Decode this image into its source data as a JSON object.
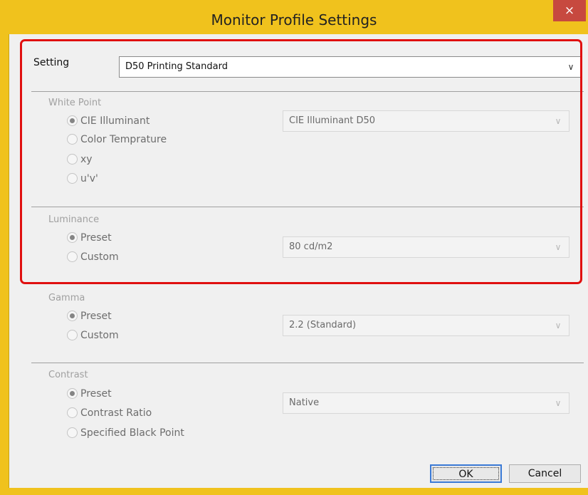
{
  "window": {
    "title": "Monitor Profile Settings",
    "close_label": "×"
  },
  "setting": {
    "label": "Setting",
    "value": "D50 Printing Standard"
  },
  "white_point": {
    "title": "White Point",
    "options": [
      "CIE Illuminant",
      "Color Temprature",
      "xy",
      "u'v'"
    ],
    "selected": 0,
    "combo_value": "CIE Illuminant D50"
  },
  "luminance": {
    "title": "Luminance",
    "options": [
      "Preset",
      "Custom"
    ],
    "selected": 0,
    "combo_value": "80 cd/m2"
  },
  "gamma": {
    "title": "Gamma",
    "options": [
      "Preset",
      "Custom"
    ],
    "selected": 0,
    "combo_value": "2.2 (Standard)"
  },
  "contrast": {
    "title": "Contrast",
    "options": [
      "Preset",
      "Contrast Ratio",
      "Specified Black Point"
    ],
    "selected": 0,
    "combo_value": "Native"
  },
  "buttons": {
    "ok": "OK",
    "cancel": "Cancel"
  },
  "colors": {
    "title_bar": "#f0c21d",
    "close": "#c7493f",
    "highlight": "#e01010"
  }
}
